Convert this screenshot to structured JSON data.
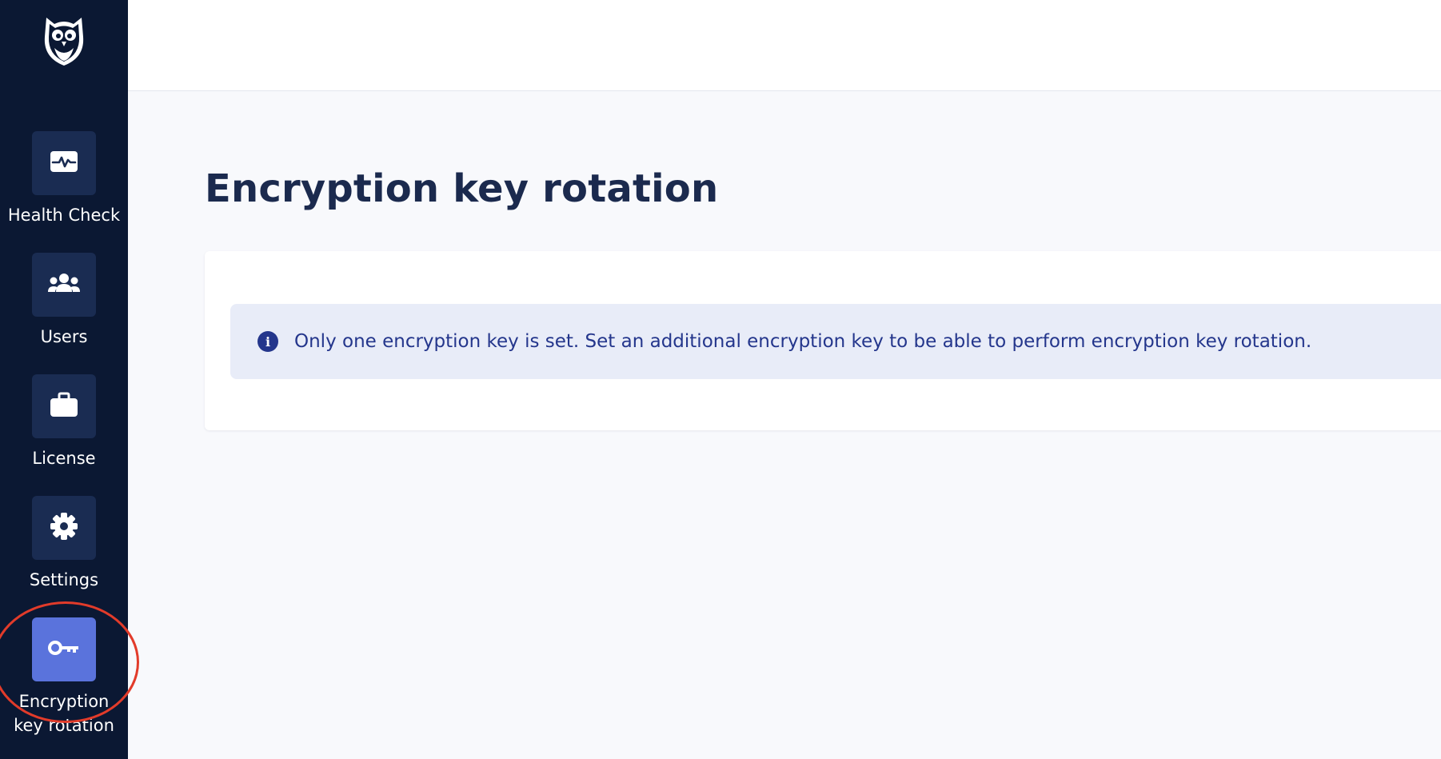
{
  "sidebar": {
    "logo_icon": "owl-logo-icon",
    "items": [
      {
        "label": "Health Check",
        "icon": "heart-pulse-icon",
        "active": false
      },
      {
        "label": "Users",
        "icon": "users-icon",
        "active": false
      },
      {
        "label": "License",
        "icon": "briefcase-icon",
        "active": false
      },
      {
        "label": "Settings",
        "icon": "gear-icon",
        "active": false
      },
      {
        "label": "Encryption key rotation",
        "icon": "key-icon",
        "active": true
      }
    ]
  },
  "main": {
    "title": "Encryption key rotation",
    "alert": {
      "icon": "info-icon",
      "icon_glyph": "i",
      "text": "Only one encryption key is set. Set an additional encryption key to be able to perform encryption key rotation."
    }
  },
  "colors": {
    "sidebar_bg": "#0b1833",
    "tile_bg": "#1a2c52",
    "active_tile_bg": "#5a73dc",
    "title": "#1b2a4e",
    "alert_bg": "#e8ecf8",
    "alert_text": "#24368c",
    "highlight": "#e23b2a"
  }
}
